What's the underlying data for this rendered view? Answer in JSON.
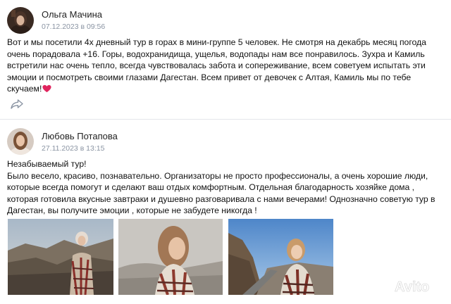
{
  "reviews": [
    {
      "author": "Ольга Мачина",
      "date": "07.12.2023 в 09:56",
      "text": "Вот и мы посетили 4х дневный тур в горах в мини-группе 5 человек. Не смотря на декабрь месяц погода очень порадовала +16. Горы, водохранидища, ущелья, водопады нам все понравилось. Зухра и Камиль встретили нас очень тепло, всегда чувствовалась забота и сопереживание, всем советуем испытать эти эмоции и посмотреть своими глазами Дагестан. Всем привет от девочек с Алтая, Камиль мы по тебе скучаем!",
      "emoji": "heart-emoji",
      "share_icon": "share-icon"
    },
    {
      "author": "Любовь Потапова",
      "date": "27.11.2023 в 13:15",
      "text_lines": [
        "Незабываемый тур!",
        "Было весело, красиво, познавательно. Организаторы не просто профессионалы, а очень хорошие люди, которые всегда помогут и сделают ваш отдых комфортным. Отдельная благодарность хозяйке дома , которая готовила вкусные завтраки и душевно разговаривала с нами вечерами! Однозначно советую тур в Дагестан, вы получите эмоции , которые не забудете никогда !"
      ],
      "photos": [
        "mountain-photo",
        "portrait-photo",
        "selfie-photo"
      ]
    }
  ],
  "watermark": "Avito"
}
